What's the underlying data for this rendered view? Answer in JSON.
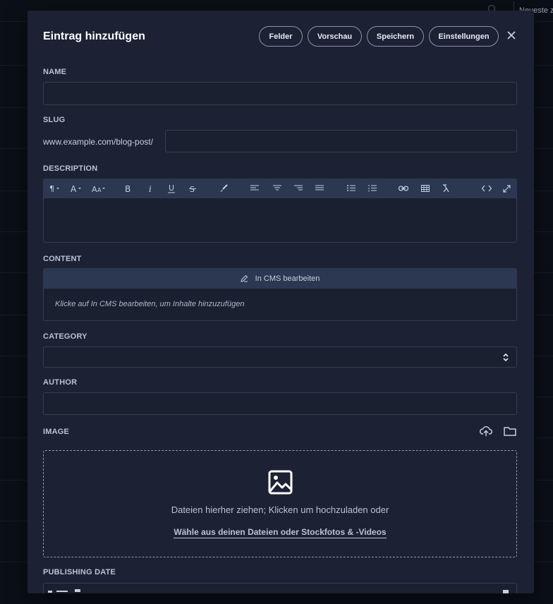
{
  "background": {
    "sort_label": "Neueste z"
  },
  "modal": {
    "title": "Eintrag hinzufügen",
    "buttons": {
      "fields": "Felder",
      "preview": "Vorschau",
      "save": "Speichern",
      "settings": "Einstellungen"
    },
    "close_icon": "close-icon"
  },
  "form": {
    "name": {
      "label": "NAME",
      "value": ""
    },
    "slug": {
      "label": "SLUG",
      "prefix": "www.example.com/blog-post/",
      "value": ""
    },
    "description": {
      "label": "DESCRIPTION",
      "toolbar": [
        "paragraph",
        "font",
        "font-size",
        "bold",
        "italic",
        "underline",
        "strikethrough",
        "brush",
        "align-left",
        "align-center",
        "align-right",
        "justify",
        "bullet-list",
        "numbered-list",
        "link",
        "table",
        "clear-format",
        "code-view",
        "fullscreen"
      ],
      "value": ""
    },
    "content": {
      "label": "CONTENT",
      "edit_button": "In CMS bearbeiten",
      "hint": "Klicke auf In CMS bearbeiten, um Inhalte hinzuzufügen"
    },
    "category": {
      "label": "CATEGORY",
      "value": ""
    },
    "author": {
      "label": "AUTHOR",
      "value": ""
    },
    "image": {
      "label": "IMAGE",
      "drop_text": "Dateien hierher ziehen; Klicken um hochzuladen oder",
      "choose_link": "Wähle aus deinen Dateien oder Stockfotos & -Videos"
    },
    "publishing_date": {
      "label": "PUBLISHING DATE"
    }
  },
  "colors": {
    "backdrop": "#0b0f17",
    "modal": "#1c2233",
    "toolbar": "#2c3852",
    "border": "#343d52"
  }
}
